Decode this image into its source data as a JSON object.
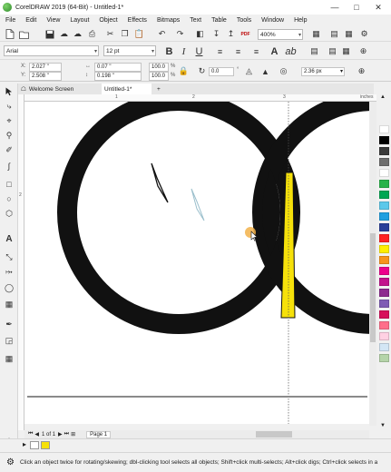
{
  "window": {
    "title": "CorelDRAW 2019 (64-Bit) - Untitled-1*"
  },
  "menu": [
    "File",
    "Edit",
    "View",
    "Layout",
    "Object",
    "Effects",
    "Bitmaps",
    "Text",
    "Table",
    "Tools",
    "Window",
    "Help"
  ],
  "standard_toolbar": {
    "zoom_value": "400%"
  },
  "text_toolbar": {
    "font_name": "Arial",
    "font_size": "12 pt",
    "bold": "B",
    "italic": "I",
    "underline": "U"
  },
  "property_bar": {
    "x": "2.027 \"",
    "y": "2.508 \"",
    "width": "0.07 \"",
    "height": "0.198 \"",
    "scale_x": "100.0",
    "scale_y": "100.0",
    "percent": "%",
    "angle": "0.0",
    "outline_width": "2.36 px"
  },
  "tabs": {
    "welcome": "Welcome Screen",
    "document": "Untitled-1*",
    "add": "+"
  },
  "rulers": {
    "h_tick_1": "1",
    "h_tick_2": "2",
    "h_tick_3": "3",
    "h_unit": "inches",
    "v_tick": "2"
  },
  "page_nav": {
    "counter": "1 of 1",
    "page_tab": "Page 1"
  },
  "status": {
    "hint": "Click an object twice for rotating/skewing; dbl-clicking tool selects all objects; Shift+click multi-selects; Alt+click digs; Ctrl+click selects in a"
  },
  "colors": {
    "ring": "#111111",
    "fill_yellow": "#f6e10a",
    "palette": [
      "#ffffff",
      "#000000",
      "#3a3a3a",
      "#6f6f6f",
      "#ffffff",
      "#28b34a",
      "#00a652",
      "#5cc8ea",
      "#1f9fe0",
      "#2a3f99",
      "#ff2222",
      "#ffee00",
      "#f7941d",
      "#ec008c",
      "#c2128c",
      "#8e2a8f",
      "#7e5cb4",
      "#d70f5b",
      "#ff6f8a",
      "#ffd1e3",
      "#d3e6f5",
      "#b5d4a9"
    ]
  },
  "icons": {
    "toolbox": [
      "pick-icon",
      "freehand-pick-icon",
      "shape-icon",
      "crop-icon",
      "zoom-icon",
      "freehand-icon",
      "artistic-media-icon",
      "rectangle-icon",
      "ellipse-icon",
      "polygon-icon",
      "text-icon",
      "parallel-dimension-icon",
      "connector-icon",
      "blend-icon",
      "transparency-icon",
      "eyedropper-icon",
      "interactive-fill-icon",
      "smart-fill-icon",
      "add-tool-icon"
    ]
  }
}
